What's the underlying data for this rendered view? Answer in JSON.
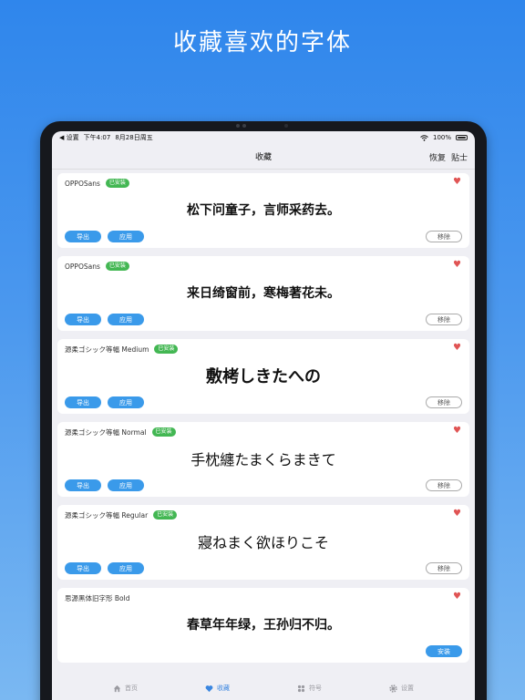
{
  "headline": "收藏喜欢的字体",
  "statusbar": {
    "back_app": "◀ 设置",
    "time": "下午4:07",
    "date": "8月28日周五",
    "battery": "100%"
  },
  "navbar": {
    "title": "收藏",
    "restore_label": "恢复",
    "tips_label": "贴士"
  },
  "cards": [
    {
      "name": "OPPOSans",
      "badge": "已安装",
      "sample": "松下问童子，言师采药去。",
      "export_label": "导出",
      "apply_label": "应用",
      "action_label": "移除"
    },
    {
      "name": "OPPOSans",
      "badge": "已安装",
      "sample": "来日绮窗前，寒梅著花未。",
      "export_label": "导出",
      "apply_label": "应用",
      "action_label": "移除"
    },
    {
      "name": "源柔ゴシック等幅 Medium",
      "badge": "已安装",
      "sample": "敷栲しきたへの",
      "export_label": "导出",
      "apply_label": "应用",
      "action_label": "移除"
    },
    {
      "name": "源柔ゴシック等幅 Normal",
      "badge": "已安装",
      "sample": "手枕纏たまくらまきて",
      "export_label": "导出",
      "apply_label": "应用",
      "action_label": "移除"
    },
    {
      "name": "源柔ゴシック等幅 Regular",
      "badge": "已安装",
      "sample": "寢ねまく欲ほりこそ",
      "export_label": "导出",
      "apply_label": "应用",
      "action_label": "移除"
    },
    {
      "name": "思源黑体旧字形 Bold",
      "sample": "春草年年绿，王孙归不归。",
      "action_label": "安装"
    }
  ],
  "tabbar": {
    "home": "首页",
    "favorites": "收藏",
    "symbols": "符号",
    "settings": "设置"
  },
  "colors": {
    "accent": "#3a9aea",
    "installed_badge": "#43b753",
    "heart": "#e05454"
  }
}
